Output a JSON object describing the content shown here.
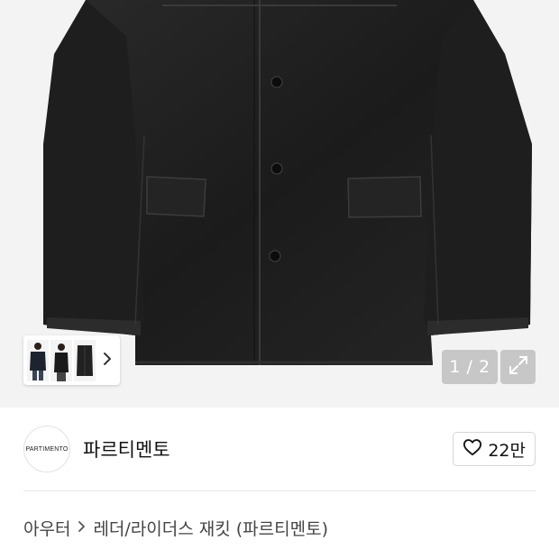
{
  "gallery": {
    "counter": "1 / 2",
    "colors": {
      "background": "#f3f3f3",
      "jacket": "#222222",
      "overlay": "rgba(0,0,0,0.18)"
    }
  },
  "shop": {
    "logo_text": "PARTIMENTO",
    "name": "파르티멘토",
    "like_count": "22만"
  },
  "breadcrumb": {
    "items": [
      "아우터",
      "레더/라이더스 재킷 (파르티멘토)"
    ]
  }
}
